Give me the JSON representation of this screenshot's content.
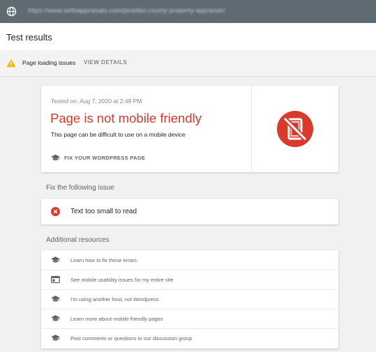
{
  "browser": {
    "url": "https://www.sefloappraisals.com/pinellas-county-property-appraiser/"
  },
  "header": {
    "title": "Test results"
  },
  "issues_bar": {
    "label": "Page loading issues",
    "details_label": "VIEW DETAILS"
  },
  "result": {
    "tested_on": "Tested on: Aug 7, 2020 at 2:48 PM",
    "verdict": "Page is not mobile friendly",
    "verdict_sub": "This page can be difficult to use on a mobile device",
    "fix_label": "FIX YOUR WORDPRESS PAGE",
    "verdict_color": "#d93a2b"
  },
  "issues_section": {
    "title": "Fix the following issue",
    "items": [
      "Text too small to read"
    ]
  },
  "resources_section": {
    "title": "Additional resources",
    "items": [
      {
        "label": "Learn how to fix these errors",
        "icon": "graduation-cap-icon"
      },
      {
        "label": "See mobile usability issues for my entire site",
        "icon": "browser-window-icon"
      },
      {
        "label": "I'm using another host, not Wordpress",
        "icon": "graduation-cap-icon"
      },
      {
        "label": "Learn more about mobile-friendly pages",
        "icon": "graduation-cap-icon"
      },
      {
        "label": "Post comments or questions to our discussion group",
        "icon": "graduation-cap-icon"
      }
    ]
  }
}
